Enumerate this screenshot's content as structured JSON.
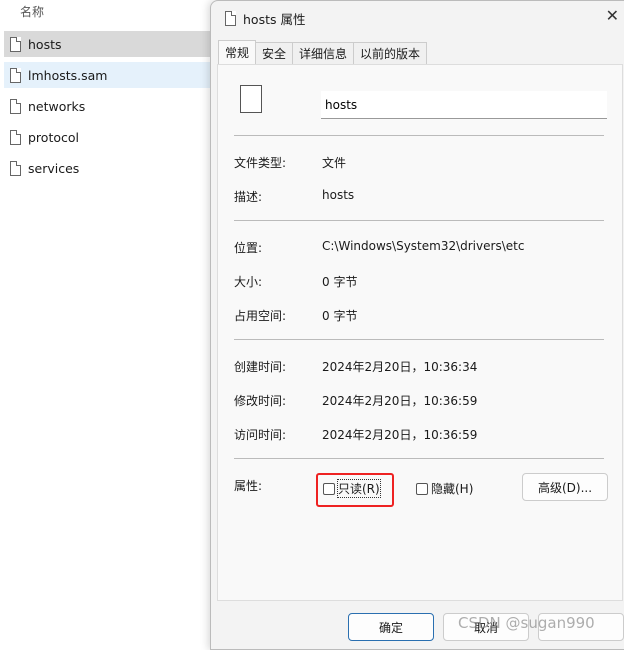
{
  "explorer": {
    "column_header": "名称",
    "files": [
      {
        "name": "hosts",
        "state": "selected"
      },
      {
        "name": "lmhosts.sam",
        "state": "hover"
      },
      {
        "name": "networks"
      },
      {
        "name": "protocol"
      },
      {
        "name": "services"
      }
    ]
  },
  "dialog": {
    "title": "hosts 属性",
    "tabs": [
      "常规",
      "安全",
      "详细信息",
      "以前的版本"
    ],
    "active_tab": "常规",
    "filename": "hosts",
    "type_label": "文件类型:",
    "type_value": "文件",
    "desc_label": "描述:",
    "desc_value": "hosts",
    "location_label": "位置:",
    "location_value": "C:\\Windows\\System32\\drivers\\etc",
    "size_label": "大小:",
    "size_value": "0 字节",
    "disk_label": "占用空间:",
    "disk_value": "0 字节",
    "created_label": "创建时间:",
    "created_value": "2024年2月20日，10:36:34",
    "modified_label": "修改时间:",
    "modified_value": "2024年2月20日，10:36:59",
    "accessed_label": "访问时间:",
    "accessed_value": "2024年2月20日，10:36:59",
    "attr_label": "属性:",
    "readonly_label": "只读(R)",
    "readonly_checked": false,
    "hidden_label": "隐藏(H)",
    "hidden_checked": false,
    "advanced_label": "高级(D)...",
    "ok_label": "确定",
    "cancel_label": "取消",
    "highlight_color": "#e22222"
  },
  "watermark": "CSDN @sugan990"
}
